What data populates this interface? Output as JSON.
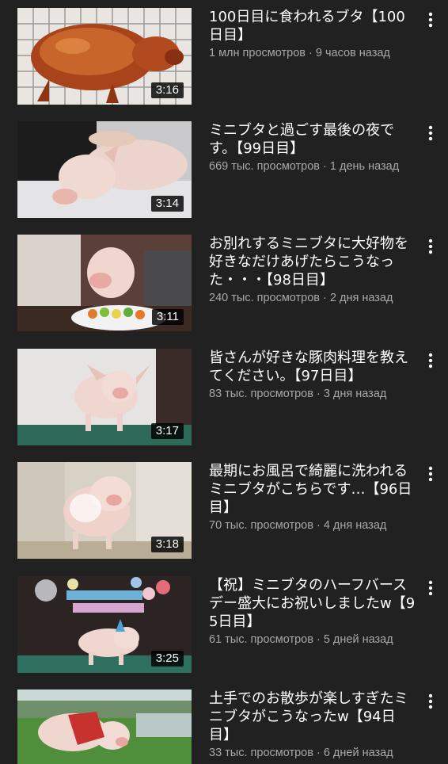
{
  "videos": [
    {
      "title": "100日目に食われるブタ【100日目】",
      "meta": "1 млн просмотров · 9 часов назад",
      "duration": "3:16",
      "thumb": "roast-pig"
    },
    {
      "title": "ミニブタと過ごす最後の夜です。【99日目】",
      "meta": "669 тыс. просмотров · 1 день назад",
      "duration": "3:14",
      "thumb": "pig-sleeping"
    },
    {
      "title": "お別れするミニブタに大好物を好きなだけあげたらこうなった・・・【98日目】",
      "meta": "240 тыс. просмотров · 2 дня назад",
      "duration": "3:11",
      "thumb": "pig-eating"
    },
    {
      "title": "皆さんが好きな豚肉料理を教えてください。【97日目】",
      "meta": "83 тыс. просмотров · 3 дня назад",
      "duration": "3:17",
      "thumb": "pig-standing"
    },
    {
      "title": "最期にお風呂で綺麗に洗われるミニブタがこちらです…【96日目】",
      "meta": "70 тыс. просмотров · 4 дня назад",
      "duration": "3:18",
      "thumb": "pig-bath"
    },
    {
      "title": "【祝】ミニブタのハーフバースデー盛大にお祝いしましたw【95日目】",
      "meta": "61 тыс. просмотров · 5 дней назад",
      "duration": "3:25",
      "thumb": "pig-birthday"
    },
    {
      "title": "土手でのお散歩が楽しすぎたミニブタがこうなったw【94日目】",
      "meta": "33 тыс. просмотров · 6 дней назад",
      "duration": "",
      "thumb": "pig-walk"
    }
  ],
  "colors": {
    "background": "#212121",
    "title": "#ffffff",
    "meta": "#a8a8a8"
  },
  "icons": {
    "menu": "more-vert-icon"
  }
}
